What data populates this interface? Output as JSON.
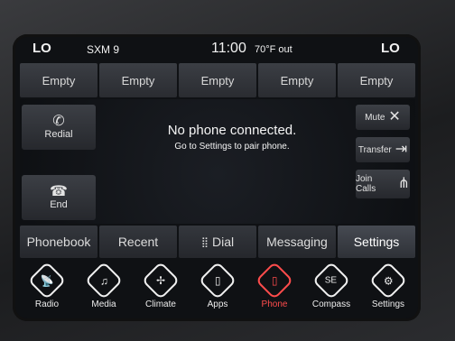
{
  "status": {
    "left_label": "LO",
    "radio": "SXM 9",
    "time": "11:00",
    "temp": "70°F out",
    "right_label": "LO"
  },
  "presets": [
    "Empty",
    "Empty",
    "Empty",
    "Empty",
    "Empty"
  ],
  "call_buttons": {
    "redial": "Redial",
    "end": "End",
    "mute": "Mute",
    "transfer": "Transfer",
    "join": "Join Calls"
  },
  "message": {
    "title": "No phone connected.",
    "subtitle": "Go to Settings to pair phone."
  },
  "tabs": [
    "Phonebook",
    "Recent",
    "Dial",
    "Messaging",
    "Settings"
  ],
  "nav": [
    "Radio",
    "Media",
    "Climate",
    "Apps",
    "Phone",
    "Compass",
    "Settings"
  ],
  "icons": {
    "radio": "radio-tower-icon",
    "media": "music-note-icon",
    "climate": "fan-icon",
    "apps": "apps-icon",
    "phone": "phone-icon",
    "compass": "compass-icon",
    "settings": "gear-icon"
  },
  "colors": {
    "active_nav": "#ff4c4c"
  }
}
